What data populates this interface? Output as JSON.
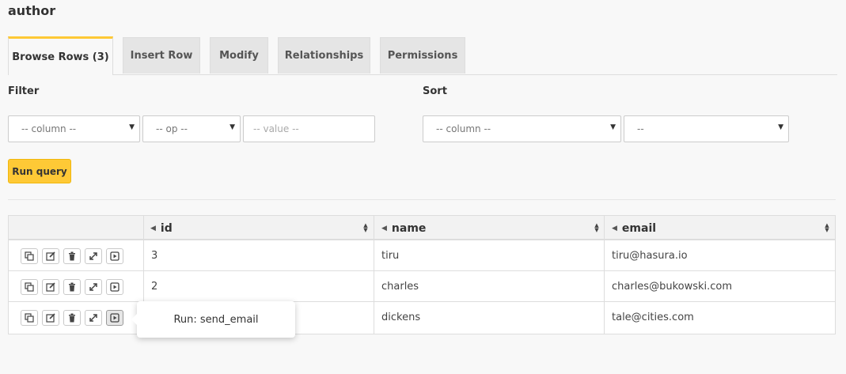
{
  "page": {
    "title": "author"
  },
  "tabs": [
    {
      "label": "Browse Rows (3)"
    },
    {
      "label": "Insert Row"
    },
    {
      "label": "Modify"
    },
    {
      "label": "Relationships"
    },
    {
      "label": "Permissions"
    }
  ],
  "filter": {
    "label": "Filter",
    "column_value": "-- column --",
    "op_value": "-- op --",
    "value_placeholder": "-- value --"
  },
  "sort": {
    "label": "Sort",
    "column_value": "-- column --",
    "order_value": "--"
  },
  "run_query_label": "Run query",
  "table": {
    "columns": [
      {
        "label": "id"
      },
      {
        "label": "name"
      },
      {
        "label": "email"
      }
    ],
    "rows": [
      {
        "id": "3",
        "name": "tiru",
        "email": "tiru@hasura.io"
      },
      {
        "id": "2",
        "name": "charles",
        "email": "charles@bukowski.com"
      },
      {
        "id": "",
        "name": "dickens",
        "email": "tale@cities.com"
      }
    ]
  },
  "tooltip": {
    "text": "Run: send_email"
  },
  "colors": {
    "accent": "#fec936",
    "border": "#dddddd",
    "background": "#f8f8f8"
  },
  "icons": [
    "clone-icon",
    "edit-icon",
    "trash-icon",
    "expand-icon",
    "run-event-icon"
  ]
}
